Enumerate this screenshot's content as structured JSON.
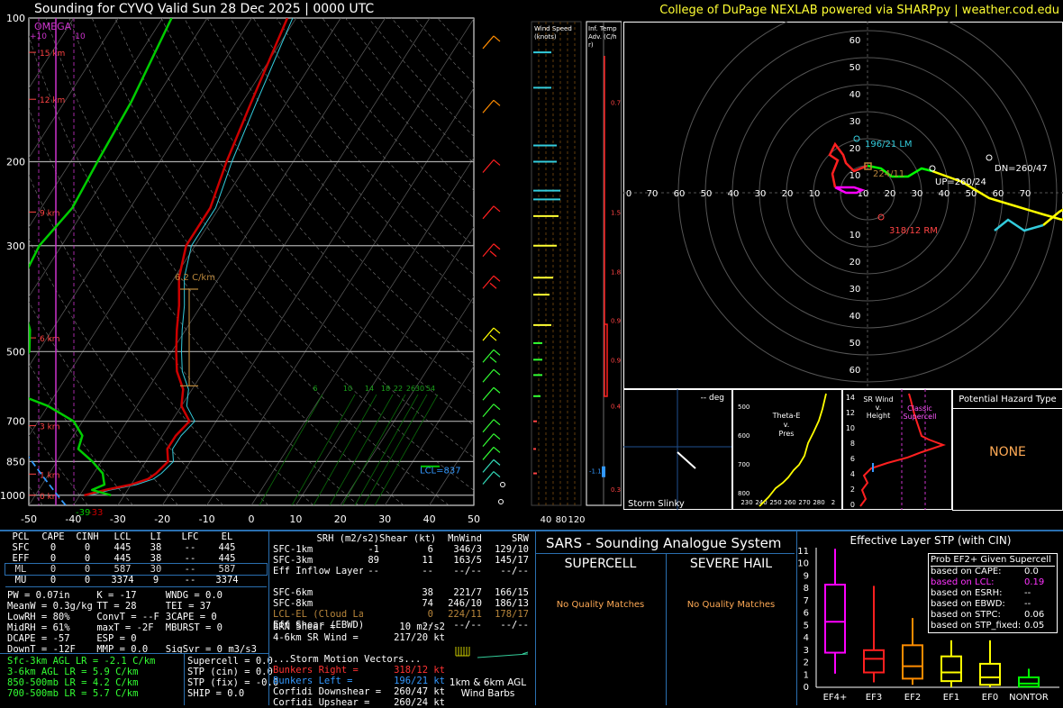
{
  "header": {
    "title": "Sounding for CYVQ Valid  Sun 28 Dec 2025 | 0000 UTC",
    "credit": "College of DuPage NEXLAB powered via SHARPpy | weather.cod.edu"
  },
  "skewt": {
    "pressure_ticks": [
      "100",
      "200",
      "300",
      "500",
      "700",
      "850",
      "1000"
    ],
    "temp_ticks": [
      "-50",
      "-40",
      "-30",
      "-20",
      "-10",
      "0",
      "10",
      "20",
      "30",
      "40",
      "50"
    ],
    "height_labels": [
      "15 km",
      "12 km",
      "9 km",
      "6 km",
      "3 km",
      "1 km",
      "0 km"
    ],
    "omega_label": "OMEGA",
    "omega_ticks": [
      "+10",
      "-10"
    ],
    "lapse_rate_label": "6.2 C/km",
    "lcl_label": "LCL",
    "lcl_value": "LCL=837",
    "sfc_temp": "-39",
    "sfc_dewpt": "-33",
    "mixing_ratios": [
      "6",
      "10",
      "14",
      "18",
      "22",
      "26",
      "30",
      "54"
    ],
    "wind_speed_title": "Wind Speed (knots)",
    "wind_speed_ticks": [
      "40",
      "80",
      "120"
    ],
    "inf_temp_title": "Inf. Temp. Adv. (C/hr)",
    "inf_temp_ticks": [
      "0.7",
      "1.5",
      "1.8",
      "0.9",
      "0.9",
      "0.4",
      "0.3"
    ],
    "inf_temp_sfc": "-1.1"
  },
  "chart_data": [
    {
      "type": "line",
      "title": "Skew-T Log-P",
      "x_units": "C",
      "y_units": "mb",
      "ylim": [
        1000,
        100
      ],
      "xlim": [
        -50,
        50
      ],
      "series": [
        {
          "name": "Temperature",
          "color": "#cc0000",
          "p": [
            1000,
            975,
            950,
            925,
            900,
            850,
            800,
            750,
            700,
            650,
            600,
            550,
            500,
            450,
            400,
            350,
            300,
            250,
            200,
            150,
            100
          ],
          "values": [
            -39,
            -35,
            -30,
            -27,
            -26,
            -25,
            -27,
            -27,
            -26,
            -30,
            -32,
            -36,
            -39,
            -42,
            -45,
            -49,
            -52,
            -52,
            -55,
            -58,
            -62
          ]
        },
        {
          "name": "Dewpoint",
          "color": "#00cc00",
          "p": [
            1000,
            975,
            950,
            925,
            900,
            850,
            800,
            750,
            700,
            650,
            600,
            550,
            500,
            450,
            400,
            350,
            300,
            250,
            200,
            150,
            100
          ],
          "values": [
            -33,
            -38,
            -36,
            -37,
            -38,
            -42,
            -47,
            -48,
            -52,
            -60,
            -72,
            -72,
            -72,
            -75,
            -80,
            -84,
            -85,
            -83,
            -84,
            -85,
            -88
          ]
        }
      ]
    },
    {
      "type": "line",
      "title": "Hodograph",
      "rings_kt": [
        10,
        20,
        30,
        40,
        50,
        60,
        70
      ],
      "axis_ticks": [
        "0",
        "70",
        "60",
        "50",
        "40",
        "30",
        "20",
        "10",
        "10",
        "20",
        "30",
        "40",
        "50",
        "60",
        "70"
      ],
      "axis_ticks_v": [
        "60",
        "50",
        "40",
        "30",
        "20",
        "10",
        "10",
        "20",
        "30",
        "40",
        "50",
        "60"
      ],
      "labels": {
        "lm": "196/21 LM",
        "rm": "318/12 RM",
        "mean": "224/11",
        "up": "UP=260/24",
        "dn": "DN=260/47"
      }
    },
    {
      "type": "bar",
      "title": "Effective Layer STP (with CIN)",
      "categories": [
        "EF4+",
        "EF3",
        "EF2",
        "EF1",
        "EF0",
        "NONTOR"
      ],
      "y_ticks": [
        "0",
        "1",
        "2",
        "3",
        "4",
        "5",
        "6",
        "7",
        "8",
        "9",
        "10",
        "11"
      ],
      "boxes": [
        {
          "name": "EF4+",
          "color": "#ff00ff",
          "lo": 1.1,
          "q1": 2.8,
          "med": 5.3,
          "q3": 8.3,
          "hi": 11.2
        },
        {
          "name": "EF3",
          "color": "#ff2020",
          "lo": 0.4,
          "q1": 1.2,
          "med": 2.3,
          "q3": 3.0,
          "hi": 8.2
        },
        {
          "name": "EF2",
          "color": "#ff8c00",
          "lo": 0.2,
          "q1": 0.7,
          "med": 1.7,
          "q3": 3.4,
          "hi": 5.6
        },
        {
          "name": "EF1",
          "color": "#ffff00",
          "lo": 0.0,
          "q1": 0.5,
          "med": 1.2,
          "q3": 2.5,
          "hi": 3.8
        },
        {
          "name": "EF0",
          "color": "#ffff00",
          "lo": 0.0,
          "q1": 0.2,
          "med": 0.8,
          "q3": 1.9,
          "hi": 3.8
        },
        {
          "name": "NONTOR",
          "color": "#00ff00",
          "lo": 0.0,
          "q1": 0.05,
          "med": 0.3,
          "q3": 0.8,
          "hi": 1.5
        }
      ]
    }
  ],
  "storm_slinky": {
    "title": "Storm Slinky",
    "deg": "-- deg"
  },
  "theta_e": {
    "title_1": "Theta-E",
    "title_2": "v.",
    "title_3": "Pres",
    "y_ticks": [
      "500",
      "600",
      "700",
      "800",
      "900"
    ],
    "x_ticks": [
      "230",
      "240",
      "250",
      "260",
      "270",
      "280",
      "2"
    ]
  },
  "srwind": {
    "title_1": "SR Wind",
    "title_2": "v.",
    "title_3": "Height",
    "classic": "Classic",
    "supercell": "Supercell",
    "y_ticks": [
      "14",
      "12",
      "10",
      "8",
      "6",
      "4",
      "2",
      "0"
    ]
  },
  "hazard": {
    "title": "Potential Hazard Type",
    "value": "NONE"
  },
  "parcels": {
    "headers": [
      "PCL",
      "CAPE",
      "CINH",
      "LCL",
      "LI",
      "LFC",
      "EL"
    ],
    "rows": [
      [
        "SFC",
        "0",
        "0",
        "445",
        "38",
        "--",
        "445"
      ],
      [
        "EFF",
        "0",
        "0",
        "445",
        "38",
        "--",
        "445"
      ],
      [
        "ML",
        "0",
        "0",
        "587",
        "30",
        "--",
        "587"
      ],
      [
        "MU",
        "0",
        "0",
        "3374",
        "9",
        "--",
        "3374"
      ]
    ]
  },
  "indices": {
    "col1": [
      "PW = 0.07in",
      "MeanW = 0.3g/kg",
      "LowRH = 80%",
      "MidRH = 61%",
      "DCAPE = -57",
      "DownT = -12F"
    ],
    "col2": [
      "K = -17",
      "TT = 28",
      "ConvT = --F",
      "maxT = -2F",
      "ESP = 0",
      "MMP = 0.0"
    ],
    "col3": [
      "WNDG = 0.0",
      "TEI = 37",
      "3CAPE = 0",
      "MBURST = 0",
      "",
      "SigSvr = 0 m3/s3"
    ]
  },
  "lapse": [
    "Sfc-3km AGL LR = -2.1 C/km",
    "3-6km AGL LR = 5.9 C/km",
    "850-500mb LR = 4.2 C/km",
    "700-500mb LR = 5.7 C/km"
  ],
  "composites": [
    "Supercell = 0.0",
    "STP (cin) = 0.0",
    "STP (fix) = -0.0",
    "SHIP = 0.0"
  ],
  "kinematics": {
    "headers": [
      "SRH (m2/s2)",
      "Shear (kt)",
      "MnWind",
      "SRW"
    ],
    "rows": [
      [
        "SFC-1km",
        "-1",
        "6",
        "346/3",
        "129/10"
      ],
      [
        "SFC-3km",
        "89",
        "11",
        "163/5",
        "145/17"
      ],
      [
        "Eff Inflow Layer",
        "--",
        "--",
        "--/--",
        "--/--"
      ],
      [
        "",
        "",
        "",
        "",
        ""
      ],
      [
        "SFC-6km",
        "",
        "38",
        "221/7",
        "166/15"
      ],
      [
        "SFC-8km",
        "",
        "74",
        "246/10",
        "186/13"
      ],
      [
        "LCL-EL (Cloud Layer)",
        "",
        "0",
        "224/11",
        "178/17"
      ],
      [
        "Eff Shear (EBWD)",
        "",
        "--",
        "--/--",
        "--/--"
      ]
    ],
    "brn_shear": "BRN Shear =",
    "brn_shear_val": "10 m2/s2",
    "sr46": "4-6km SR Wind =",
    "sr46_val": "217/20 kt",
    "storm_vectors": "...Storm Motion Vectors...",
    "br": "Bunkers Right =",
    "br_val": "318/12 kt",
    "bl": "Bunkers Left =",
    "bl_val": "196/21 kt",
    "cd": "Corfidi Downshear =",
    "cd_val": "260/47 kt",
    "cu": "Corfidi Upshear =",
    "cu_val": "260/24 kt",
    "barb_title_1": "1km & 6km AGL",
    "barb_title_2": "Wind Barbs"
  },
  "sars": {
    "title": "SARS - Sounding Analogue System",
    "supercell": "SUPERCELL",
    "hail": "SEVERE HAIL",
    "no_match": "No Quality Matches"
  },
  "stp_box": {
    "title": "Prob EF2+ Given Supercell",
    "rows": [
      [
        "based on CAPE:",
        "0.0"
      ],
      [
        "based on LCL:",
        "0.19"
      ],
      [
        "based on ESRH:",
        "--"
      ],
      [
        "based on EBWD:",
        "--"
      ],
      [
        "based on STPC:",
        "0.06"
      ],
      [
        "based on STP_fixed:",
        "0.05"
      ]
    ]
  }
}
